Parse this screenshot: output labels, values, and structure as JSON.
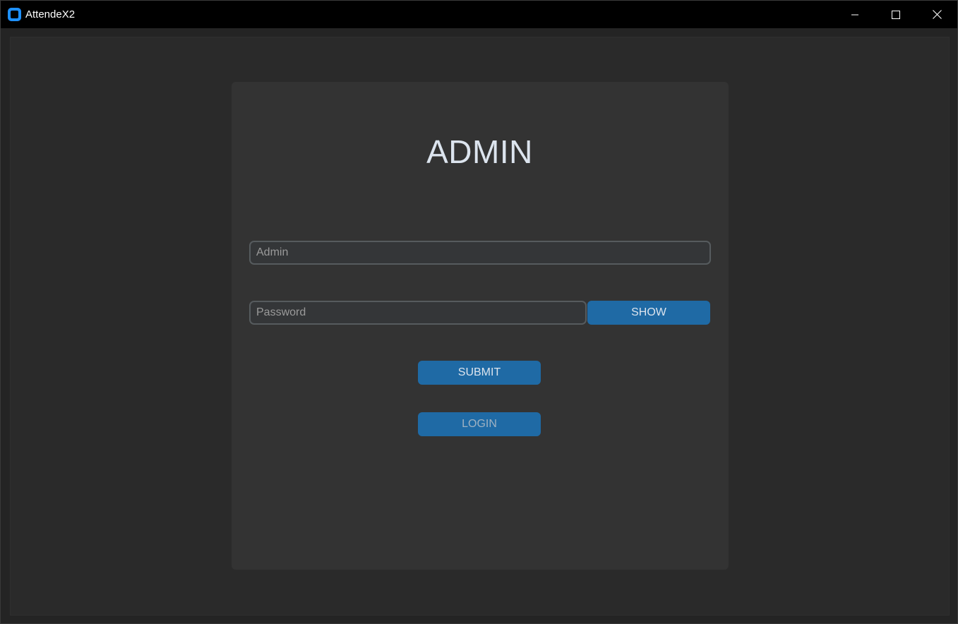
{
  "window": {
    "title": "AttendeX2",
    "controls": [
      "minimize-icon",
      "maximize-icon",
      "close-icon"
    ]
  },
  "login": {
    "heading": "ADMIN",
    "username_placeholder": "Admin",
    "password_placeholder": "Password",
    "show_label": "SHOW",
    "submit_label": "SUBMIT",
    "login_label": "LOGIN"
  },
  "colors": {
    "accent": "#1f6aa5",
    "background": "#2a2a2a",
    "card": "#333333",
    "titlebar": "#000000"
  }
}
